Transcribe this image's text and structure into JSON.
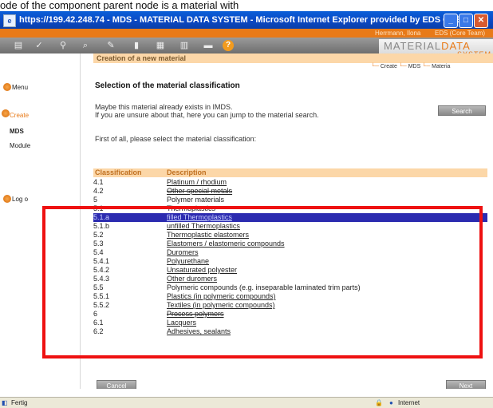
{
  "caption": "ode of the component parent node is a material with",
  "window": {
    "title": "https://199.42.248.74 - MDS - MATERIAL DATA SYSTEM - Microsoft Internet Explorer provided by EDS COE"
  },
  "userbar": {
    "user": "Herrmann, Ilona",
    "org": "EDS (Core Team)"
  },
  "brand": {
    "name_a": "MATERIAL",
    "name_b": "DATA",
    "system": "SYSTEM"
  },
  "nav": {
    "menu": "Menu",
    "create": "Create",
    "mds": "MDS",
    "module": "Module",
    "logout": "Log o"
  },
  "section_title": "Creation of a new material",
  "breadcrumb": {
    "create": "Create",
    "mds": "MDS",
    "material": "Materia"
  },
  "heading": "Selection of the material classification",
  "info_line1": "Maybe this material already exists in IMDS.",
  "info_line2": "If you are unsure about that, here you can jump to the material search.",
  "search_button": "Search",
  "prompt": "First of all, please select the material classification:",
  "table": {
    "col_classification": "Classification",
    "col_description": "Description",
    "rows": [
      {
        "cls": "4.1",
        "desc": "Platinum / rhodium",
        "link": true
      },
      {
        "cls": "4.2",
        "desc": "Other special metals",
        "link": true
      },
      {
        "cls": "5",
        "desc": "Polymer materials",
        "link": false
      },
      {
        "cls": "5.1",
        "desc": "Thermoplastics",
        "link": false
      },
      {
        "cls": "5.1.a",
        "desc": "filled Thermoplastics",
        "link": true
      },
      {
        "cls": "5.1.b",
        "desc": "unfilled Thermoplastics",
        "link": true
      },
      {
        "cls": "5.2",
        "desc": "Thermoplastic elastomers",
        "link": true
      },
      {
        "cls": "5.3",
        "desc": "Elastomers / elastomeric compounds",
        "link": true
      },
      {
        "cls": "5.4",
        "desc": "Duromers",
        "link": true
      },
      {
        "cls": "5.4.1",
        "desc": "Polyurethane",
        "link": true
      },
      {
        "cls": "5.4.2",
        "desc": "Unsaturated polyester",
        "link": true
      },
      {
        "cls": "5.4.3",
        "desc": "Other duromers",
        "link": true
      },
      {
        "cls": "5.5",
        "desc": "Polymeric compounds (e.g. inseparable laminated trim parts)",
        "link": false
      },
      {
        "cls": "5.5.1",
        "desc": "Plastics (in polymeric compounds)",
        "link": true
      },
      {
        "cls": "5.5.2",
        "desc": "Textiles (in polymeric compounds)",
        "link": true
      },
      {
        "cls": "6",
        "desc": "Process polymers",
        "link": false
      },
      {
        "cls": "6.1",
        "desc": "Lacquers",
        "link": true
      },
      {
        "cls": "6.2",
        "desc": "Adhesives, sealants",
        "link": true
      }
    ],
    "selected_index": 4
  },
  "cancel_button": "Cancel",
  "next_button": "Next",
  "status": {
    "text": "Fertig",
    "zone": "Internet"
  },
  "colors": {
    "accent": "#e87a18",
    "title_bar": "#0b47c2",
    "highlight": "#ee1111",
    "selection": "#2b2bb0"
  }
}
